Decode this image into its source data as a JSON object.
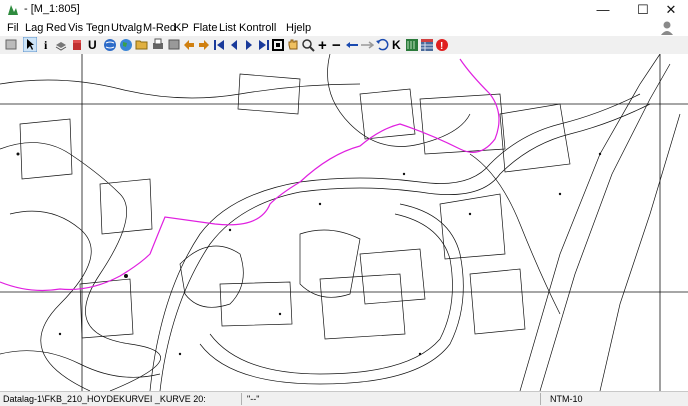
{
  "window": {
    "title": "- [M_1:805]",
    "minimize_glyph": "—",
    "maximize_glyph": "☐",
    "close_glyph": "✕"
  },
  "menu": [
    "Fil",
    "Lag",
    "Red",
    "Vis",
    "Tegn",
    "Utvalg",
    "M-Red",
    "KP",
    "Flate",
    "List",
    "Kontroll",
    "Hjelp"
  ],
  "toolbar_icons": [
    "grid-view-icon",
    "select-arrow-icon",
    "info-icon",
    "layers-icon",
    "database-icon",
    "underline-icon",
    "globe-icon",
    "earth-icon",
    "open-folder-icon",
    "print-icon",
    "arrow-left-icon",
    "arrow-right-icon",
    "first-icon",
    "previous-icon",
    "next-icon",
    "last-icon",
    "zoom-extent-icon",
    "pan-hand-icon",
    "zoom-icon",
    "zoom-in-icon",
    "zoom-out-icon",
    "move-icon",
    "measure-icon",
    "refresh-icon",
    "k-icon",
    "ruler-icon",
    "layer-table-icon",
    "stop-alert-icon"
  ],
  "toolbar_glyphs": {
    "info": "i",
    "underline": "U",
    "plus": "+",
    "minus": "−",
    "k": "K",
    "alert": "!"
  },
  "status": {
    "layer": "Datalag-1\\FKB_210_HOYDEKURVEI _KURVE 20:",
    "mode": "\"--\"",
    "crs": "NTM-10"
  },
  "colors": {
    "contour_line": "#111111",
    "highlight_path": "#e020e0",
    "toolbar_bg": "#f0f0f0",
    "app_icon": "#2e8b3e",
    "alert": "#e02020"
  }
}
